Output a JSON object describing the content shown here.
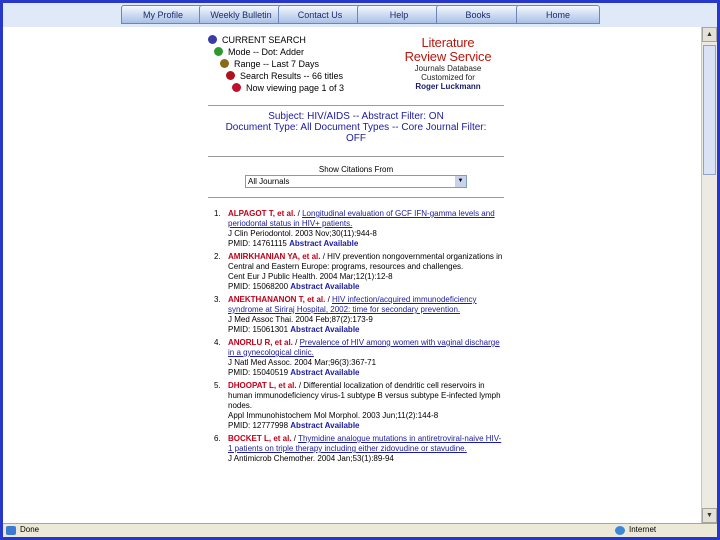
{
  "nav": {
    "tabs": [
      "My Profile",
      "Weekly Bulletin",
      "Contact Us",
      "Help",
      "Books",
      "Home"
    ]
  },
  "search": {
    "current_search": "CURRENT SEARCH",
    "mode": "Mode -- Dot: Adder",
    "range": "Range -- Last 7 Days",
    "search_results": "Search Results -- 66 titles",
    "now_viewing": "Now viewing page 1 of 3"
  },
  "brand": {
    "line1": "Literature",
    "line2": "Review Service",
    "line3": "Journals Database",
    "line4": "Customized for",
    "line5": "Roger Luckmann"
  },
  "subject": {
    "line1": "Subject: HIV/AIDS -- Abstract Filter: ON",
    "line2": "Document Type: All Document Types -- Core Journal Filter:",
    "line3": "OFF"
  },
  "show_citations": {
    "label": "Show Citations From",
    "selected": "All Journals"
  },
  "results": [
    {
      "num": "1.",
      "author": "ALPAGOT T, et al.",
      "title": "Longitudinal evaluation of GCF IFN-gamma levels and periodontal status in HIV+ patients.",
      "journal": "J Clin Periodontol. 2003 Nov;30(11):944-8",
      "pmid": "PMID: 14761115",
      "abstract": "Abstract Available"
    },
    {
      "num": "2.",
      "author": "AMIRKHANIAN YA, et al.",
      "title": "HIV prevention nongovernmental organizations in Central and Eastern Europe: programs, resources and challenges.",
      "journal": "Cent Eur J Public Health. 2004 Mar;12(1):12-8",
      "pmid": "PMID: 15068200",
      "abstract": "Abstract Available"
    },
    {
      "num": "3.",
      "author": "ANEKTHANANON T, et al.",
      "title": "HIV infection/acquired immunodeficiency syndrome at Siriraj Hospital, 2002: time for secondary prevention.",
      "journal": "J Med Assoc Thai. 2004 Feb;87(2):173-9",
      "pmid": "PMID: 15061301",
      "abstract": "Abstract Available"
    },
    {
      "num": "4.",
      "author": "ANORLU R, et al.",
      "title": "Prevalence of HIV among women with vaginal discharge in a gynecological clinic.",
      "journal": "J Natl Med Assoc. 2004 Mar;96(3):367-71",
      "pmid": "PMID: 15040519",
      "abstract": "Abstract Available"
    },
    {
      "num": "5.",
      "author": "DHOOPAT L, et al.",
      "title": "Differential localization of dendritic cell reservoirs in human immunodeficiency virus-1 subtype B versus subtype E-infected lymph nodes.",
      "journal": "Appl Immunohistochem Mol Morphol. 2003 Jun;11(2):144-8",
      "pmid": "PMID: 12777998",
      "abstract": "Abstract Available"
    },
    {
      "num": "6.",
      "author": "BOCKET L, et al.",
      "title": "Thymidine analogue mutations in antiretroviral-naive HIV-1 patients on triple therapy including either zidovudine or stavudine.",
      "journal": "J Antimicrob Chemother. 2004 Jan;53(1):89-94",
      "pmid": "",
      "abstract": ""
    }
  ],
  "status": {
    "left": "Done",
    "right": "Internet"
  },
  "colors": {
    "frame": "#2637c9",
    "author": "#c0001a",
    "link": "#1c1ca0"
  },
  "icons": {
    "crumb_dots": [
      "#3a3aa8",
      "#2e9a2e",
      "#8a6a1a",
      "#b01020",
      "#c01030"
    ]
  }
}
